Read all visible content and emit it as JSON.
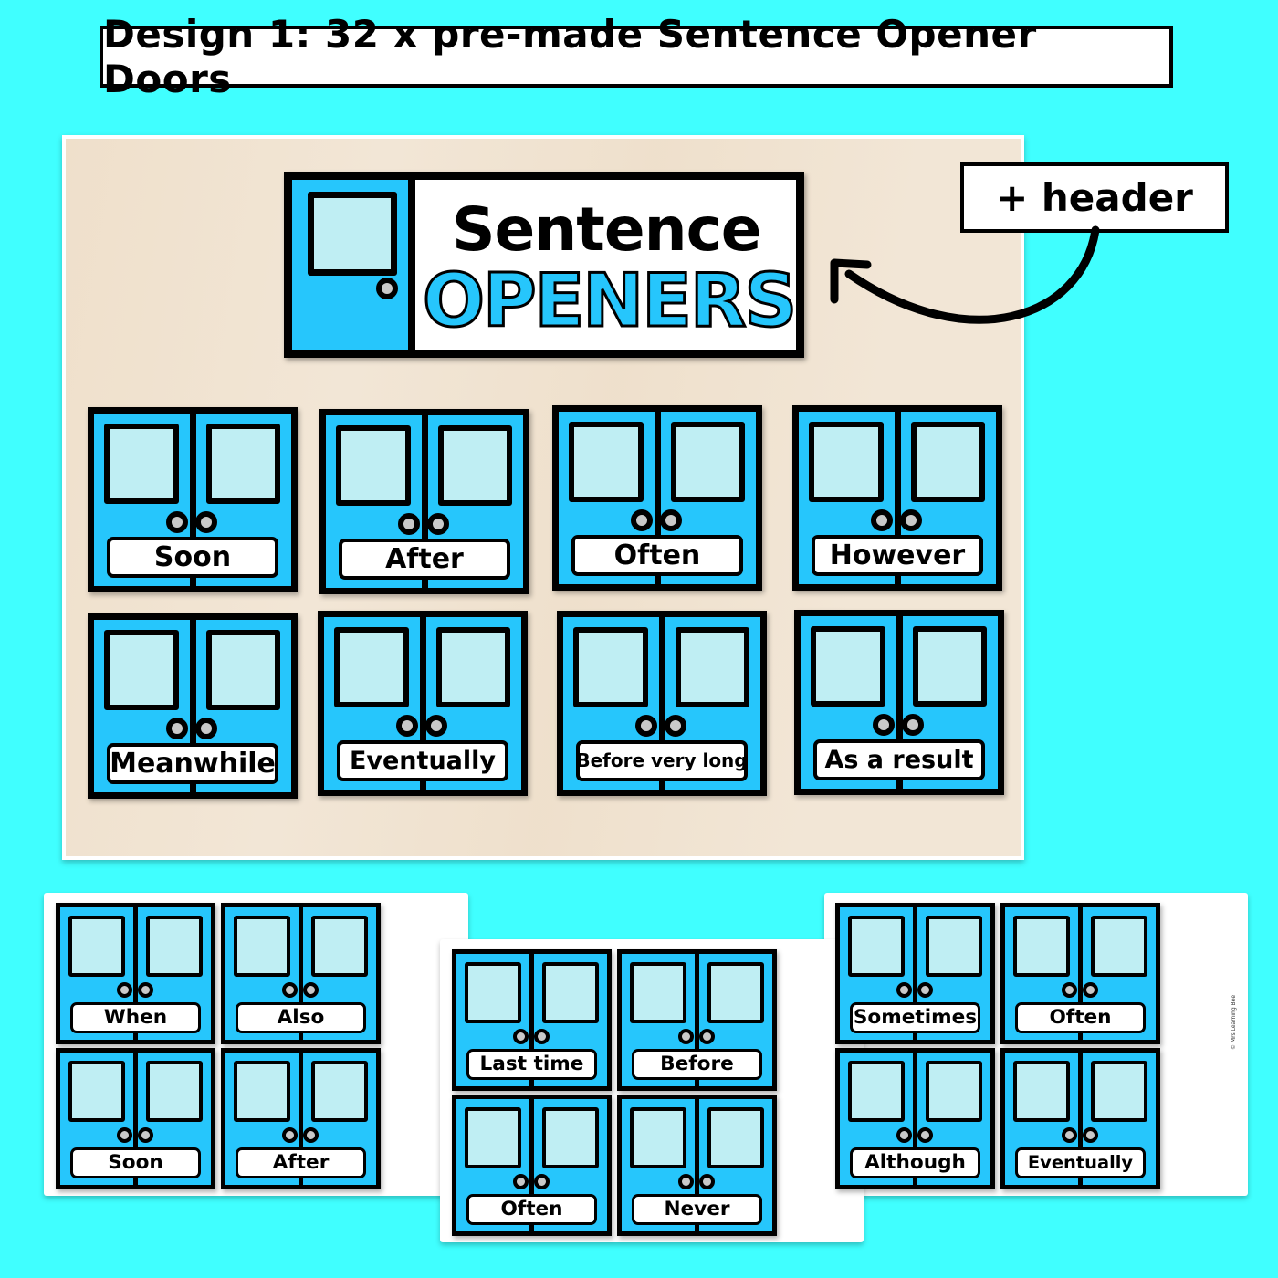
{
  "title": "Design 1: 32 x pre-made Sentence Opener Doors",
  "header_card": {
    "line1": "Sentence",
    "line2": "OPENERS",
    "icon": "door-icon"
  },
  "callout": {
    "label": "+ header",
    "icon": "curved-arrow-icon"
  },
  "colors": {
    "background": "#40ffff",
    "door_blue": "#26c6fc",
    "window": "#bfeef3",
    "knob": "#c9c9c9",
    "outline": "#000000"
  },
  "board_doors": [
    {
      "label": "Soon"
    },
    {
      "label": "After"
    },
    {
      "label": "Often"
    },
    {
      "label": "However"
    },
    {
      "label": "Meanwhile"
    },
    {
      "label": "Eventually"
    },
    {
      "label": "Before very long"
    },
    {
      "label": "As a result"
    }
  ],
  "sheets": [
    {
      "doors": [
        {
          "label": "When"
        },
        {
          "label": "Also"
        },
        {
          "label": "Soon"
        },
        {
          "label": "After"
        }
      ]
    },
    {
      "doors": [
        {
          "label": "Last time"
        },
        {
          "label": "Before"
        },
        {
          "label": "Often"
        },
        {
          "label": "Never"
        }
      ]
    },
    {
      "doors": [
        {
          "label": "Sometimes"
        },
        {
          "label": "Often"
        },
        {
          "label": "Although"
        },
        {
          "label": "Eventually"
        }
      ]
    }
  ],
  "copyright": "© Mrs Learning Bee"
}
